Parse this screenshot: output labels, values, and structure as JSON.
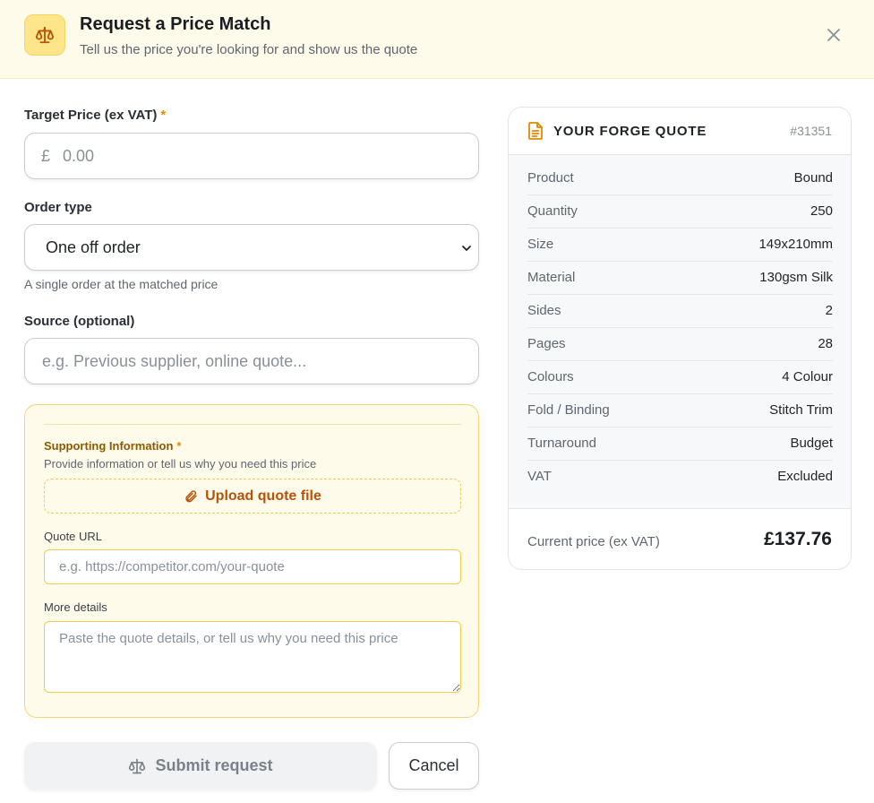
{
  "header": {
    "title": "Request a Price Match",
    "subtitle": "Tell us the price you're looking for and show us the quote",
    "icon": "scale-icon",
    "close_icon": "close-icon"
  },
  "target_price": {
    "label": "Target Price (ex VAT)",
    "required_mark": "*",
    "currency": "£",
    "placeholder": "0.00"
  },
  "order_type": {
    "label": "Order type",
    "selected": "One off order",
    "helper": "A single order at the matched price"
  },
  "source": {
    "label": "Source (optional)",
    "placeholder": "e.g. Previous supplier, online quote..."
  },
  "supporting": {
    "title": "Supporting Information",
    "required_mark": "*",
    "description": "Provide information or tell us why you need this price",
    "upload_label": "Upload quote file",
    "quote_url_label": "Quote URL",
    "quote_url_placeholder": "e.g. https://competitor.com/your-quote",
    "details_label": "More details",
    "details_placeholder": "Paste the quote details, or tell us why you need this price"
  },
  "actions": {
    "submit_label": "Submit request",
    "cancel_label": "Cancel"
  },
  "quote": {
    "title": "YOUR FORGE QUOTE",
    "id": "#31351",
    "rows": [
      {
        "label": "Product",
        "value": "Bound"
      },
      {
        "label": "Quantity",
        "value": "250"
      },
      {
        "label": "Size",
        "value": "149x210mm"
      },
      {
        "label": "Material",
        "value": "130gsm Silk"
      },
      {
        "label": "Sides",
        "value": "2"
      },
      {
        "label": "Pages",
        "value": "28"
      },
      {
        "label": "Colours",
        "value": "4 Colour"
      },
      {
        "label": "Fold / Binding",
        "value": "Stitch Trim"
      },
      {
        "label": "Turnaround",
        "value": "Budget"
      },
      {
        "label": "VAT",
        "value": "Excluded"
      }
    ],
    "price_label": "Current price (ex VAT)",
    "price_value": "£137.76"
  },
  "colors": {
    "accent": "#b45309",
    "header_bg": "#fffbea",
    "icon_bg": "#fde68a",
    "required": "#e08a00"
  }
}
